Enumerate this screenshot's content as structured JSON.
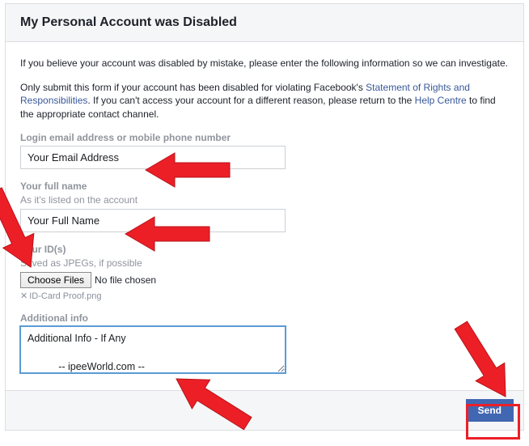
{
  "header": {
    "title": "My Personal Account was Disabled"
  },
  "intro": "If you believe your account was disabled by mistake, please enter the following information so we can investigate.",
  "para2": {
    "t1": "Only submit this form if your account has been disabled for violating Facebook's ",
    "link1": "Statement of Rights and Responsibilities",
    "t2": ". If you can't access your account for a different reason, please return to the ",
    "link2": "Help Centre",
    "t3": " to find the appropriate contact channel."
  },
  "fields": {
    "email": {
      "label": "Login email address or mobile phone number",
      "value": "Your Email Address"
    },
    "name": {
      "label": "Your full name",
      "sublabel": "As it's listed on the account",
      "value": "Your Full Name"
    },
    "id": {
      "label": "Your ID(s)",
      "sublabel": "Saved as JPEGs, if possible",
      "choose": "Choose Files",
      "nofile": "No file chosen",
      "file0": "ID-Card Proof.png"
    },
    "additional": {
      "label": "Additional info",
      "value": "Additional Info - If Any\n\n           -- ipeeWorld.com --"
    }
  },
  "footer": {
    "send": "Send"
  }
}
